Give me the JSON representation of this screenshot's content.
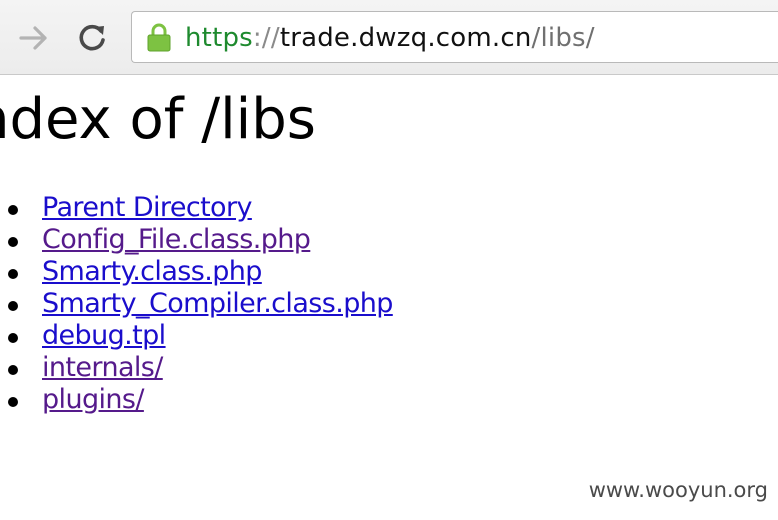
{
  "browser": {
    "nav": {
      "forward_icon": "arrow-right-icon",
      "reload_icon": "reload-icon"
    },
    "address": {
      "lock_icon": "lock-icon",
      "scheme": "https",
      "separator": "://",
      "host": "trade.dwzq.com.cn",
      "path": "/libs/"
    }
  },
  "page": {
    "title": "ndex of /libs",
    "items": [
      {
        "label": "Parent Directory",
        "state": "unvisited"
      },
      {
        "label": "Config_File.class.php",
        "state": "visited"
      },
      {
        "label": "Smarty.class.php",
        "state": "unvisited"
      },
      {
        "label": "Smarty_Compiler.class.php",
        "state": "unvisited"
      },
      {
        "label": "debug.tpl",
        "state": "unvisited"
      },
      {
        "label": "internals/",
        "state": "visited"
      },
      {
        "label": "plugins/",
        "state": "visited"
      }
    ]
  },
  "watermark": "www.wooyun.org",
  "colors": {
    "link_unvisited": "#1a0dcc",
    "link_visited": "#551a8b",
    "secure_scheme": "#1e8a2e",
    "lock_green": "#7dc242"
  }
}
